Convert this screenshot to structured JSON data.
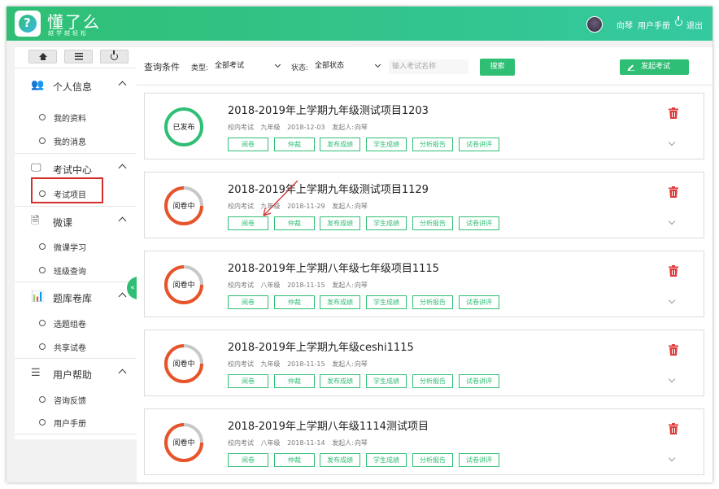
{
  "header": {
    "app_title": "懂了么",
    "app_subtitle": "越学越轻松",
    "user_name": "向琴",
    "manual_link": "用户手册",
    "logout_link": "退出"
  },
  "sidebar": {
    "sections": [
      {
        "label": "个人信息",
        "icon": "user-group-icon",
        "items": [
          "我的资料",
          "我的消息"
        ]
      },
      {
        "label": "考试中心",
        "icon": "monitor-icon",
        "items": [
          "考试项目"
        ]
      },
      {
        "label": "微课",
        "icon": "document-icon",
        "items": [
          "微课学习",
          "班级查询"
        ]
      },
      {
        "label": "题库卷库",
        "icon": "bar-chart-icon",
        "items": [
          "选题组卷",
          "共享试卷"
        ]
      },
      {
        "label": "用户帮助",
        "icon": "help-list-icon",
        "items": [
          "咨询反馈",
          "用户手册"
        ]
      }
    ],
    "highlighted_item": "考试项目"
  },
  "query": {
    "title": "查询条件",
    "type_label": "类型:",
    "type_value": "全部考试",
    "status_label": "状态:",
    "status_value": "全部状态",
    "search_placeholder": "输入考试名称",
    "search_button": "搜索",
    "launch_button": "发起考试"
  },
  "colors": {
    "accent": "#2fbf74",
    "published": "#2fbf74",
    "grading": "#e8542a",
    "delete": "#e03a3a",
    "highlight_box": "#d32f2f"
  },
  "actions": [
    "阅卷",
    "仲裁",
    "发布成绩",
    "学生成绩",
    "分析报告",
    "试卷讲评"
  ],
  "exams": [
    {
      "title": "2018-2019年上学期九年级测试项目1203",
      "status": "已发布",
      "status_kind": "published",
      "type": "校内考试",
      "grade": "九年级",
      "date": "2018-12-03",
      "creator_label": "发起人:",
      "creator": "向琴"
    },
    {
      "title": "2018-2019年上学期九年级测试项目1129",
      "status": "阅卷中",
      "status_kind": "grading",
      "type": "校内考试",
      "grade": "九年级",
      "date": "2018-11-29",
      "creator_label": "发起人:",
      "creator": "向琴"
    },
    {
      "title": "2018-2019年上学期八年级七年级项目1115",
      "status": "阅卷中",
      "status_kind": "grading",
      "type": "校内考试",
      "grade": "八年级",
      "date": "2018-11-15",
      "creator_label": "发起人:",
      "creator": "向琴"
    },
    {
      "title": "2018-2019年上学期九年级ceshi1115",
      "status": "阅卷中",
      "status_kind": "grading",
      "type": "校内考试",
      "grade": "九年级",
      "date": "2018-11-15",
      "creator_label": "发起人:",
      "creator": "向琴"
    },
    {
      "title": "2018-2019年上学期八年级1114测试项目",
      "status": "阅卷中",
      "status_kind": "grading",
      "type": "校内考试",
      "grade": "八年级",
      "date": "2018-11-14",
      "creator_label": "发起人:",
      "creator": "向琴"
    }
  ]
}
